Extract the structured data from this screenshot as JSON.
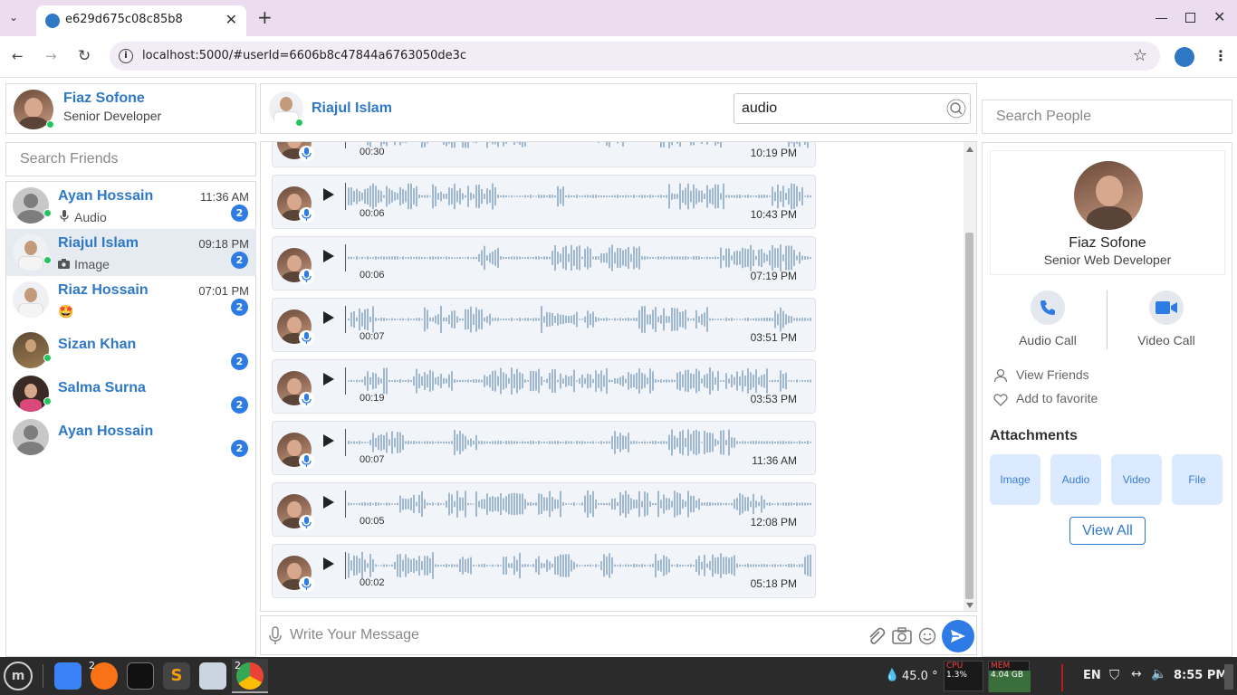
{
  "browser": {
    "tab_title": "e629d675c08c85b8",
    "url": "localhost:5000/#userId=6606b8c47844a6763050de3c"
  },
  "me": {
    "name": "Fiaz Sofone",
    "role": "Senior Developer"
  },
  "search_friends_placeholder": "Search Friends",
  "friends": [
    {
      "name": "Ayan Hossain",
      "time": "11:36 AM",
      "preview": "Audio",
      "preview_icon": "mic-icon",
      "unread": "2",
      "online": true
    },
    {
      "name": "Riajul Islam",
      "time": "09:18 PM",
      "preview": "Image",
      "preview_icon": "camera-icon",
      "unread": "2",
      "online": true
    },
    {
      "name": "Riaz Hossain",
      "time": "07:01 PM",
      "preview": "🤩",
      "preview_icon": "",
      "unread": "2",
      "online": false
    },
    {
      "name": "Sizan Khan",
      "time": "",
      "preview": "",
      "preview_icon": "",
      "unread": "2",
      "online": true
    },
    {
      "name": "Salma Surna",
      "time": "",
      "preview": "",
      "preview_icon": "",
      "unread": "2",
      "online": true
    },
    {
      "name": "Ayan Hossain",
      "time": "",
      "preview": "",
      "preview_icon": "",
      "unread": "2",
      "online": false
    }
  ],
  "chat": {
    "contact_name": "Riajul Islam",
    "search_value": "audio",
    "messages": [
      {
        "duration": "00:30",
        "time": "10:19 PM"
      },
      {
        "duration": "00:06",
        "time": "10:43 PM"
      },
      {
        "duration": "00:06",
        "time": "07:19 PM"
      },
      {
        "duration": "00:07",
        "time": "03:51 PM"
      },
      {
        "duration": "00:19",
        "time": "03:53 PM"
      },
      {
        "duration": "00:07",
        "time": "11:36 AM"
      },
      {
        "duration": "00:05",
        "time": "12:08 PM"
      },
      {
        "duration": "00:02",
        "time": "05:18 PM"
      }
    ],
    "input_placeholder": "Write Your Message"
  },
  "right": {
    "search_people_placeholder": "Search People",
    "profile_name": "Fiaz Sofone",
    "profile_role": "Senior Web Developer",
    "audio_call_label": "Audio Call",
    "video_call_label": "Video Call",
    "view_friends_label": "View Friends",
    "favorite_label": "Add to favorite",
    "attachments_heading": "Attachments",
    "attachments": [
      "Image",
      "Audio",
      "Video",
      "File"
    ],
    "view_all_label": "View All"
  },
  "taskbar": {
    "temp": "45.0 °",
    "cpu_label": "CPU",
    "cpu_value": "1.3%",
    "mem_label": "MEM",
    "mem_value": "4.04 GB",
    "lang": "EN",
    "clock": "8:55 PM",
    "firefox_count": "2",
    "chrome_count": "2"
  },
  "colors": {
    "accent": "#2f78c6",
    "badge": "#2f7be6",
    "online": "#22c55e",
    "wave": "#9fb7cf"
  }
}
